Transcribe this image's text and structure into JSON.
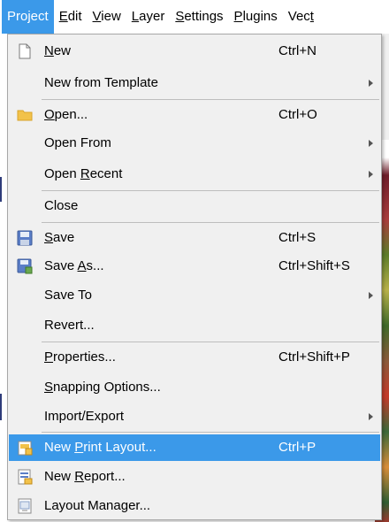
{
  "menubar": {
    "items": [
      {
        "label": "Project",
        "active": true
      },
      {
        "pre": "",
        "ul": "E",
        "post": "dit"
      },
      {
        "pre": "",
        "ul": "V",
        "post": "iew"
      },
      {
        "pre": "",
        "ul": "L",
        "post": "ayer"
      },
      {
        "pre": "",
        "ul": "S",
        "post": "ettings"
      },
      {
        "pre": "",
        "ul": "P",
        "post": "lugins"
      },
      {
        "pre": "Vec",
        "ul": "t",
        "post": ""
      }
    ]
  },
  "menu": {
    "items": [
      {
        "pre": "",
        "ul": "N",
        "post": "ew",
        "shortcut": "Ctrl+N",
        "icon": "new-file-icon"
      },
      {
        "pre": "New from Template",
        "ul": "",
        "post": "",
        "shortcut": "",
        "submenu": true
      },
      {
        "pre": "",
        "ul": "O",
        "post": "pen...",
        "shortcut": "Ctrl+O",
        "icon": "open-folder-icon"
      },
      {
        "pre": "Open From",
        "ul": "",
        "post": "",
        "shortcut": "",
        "submenu": true
      },
      {
        "pre": "Open ",
        "ul": "R",
        "post": "ecent",
        "shortcut": "",
        "submenu": true
      },
      {
        "pre": "Close",
        "ul": "",
        "post": "",
        "shortcut": ""
      },
      {
        "pre": "",
        "ul": "S",
        "post": "ave",
        "shortcut": "Ctrl+S",
        "icon": "save-icon"
      },
      {
        "pre": "Save ",
        "ul": "A",
        "post": "s...",
        "shortcut": "Ctrl+Shift+S",
        "icon": "save-as-icon"
      },
      {
        "pre": "Save To",
        "ul": "",
        "post": "",
        "shortcut": "",
        "submenu": true
      },
      {
        "pre": "Revert...",
        "ul": "",
        "post": "",
        "shortcut": ""
      },
      {
        "pre": "",
        "ul": "P",
        "post": "roperties...",
        "shortcut": "Ctrl+Shift+P"
      },
      {
        "pre": "",
        "ul": "S",
        "post": "napping Options...",
        "shortcut": ""
      },
      {
        "pre": "Import/Export",
        "ul": "",
        "post": "",
        "shortcut": "",
        "submenu": true
      },
      {
        "pre": "New ",
        "ul": "P",
        "post": "rint Layout...",
        "shortcut": "Ctrl+P",
        "icon": "print-layout-icon",
        "highlighted": true
      },
      {
        "pre": "New ",
        "ul": "R",
        "post": "eport...",
        "shortcut": "",
        "icon": "report-icon"
      },
      {
        "pre": "",
        "ul": "",
        "post": "Layout Manager...",
        "shortcut": "",
        "icon": "layout-manager-icon"
      }
    ]
  },
  "colors": {
    "highlight": "#3b99e9",
    "menu_bg": "#f0f0f0",
    "folder": "#f2c24a",
    "save": "#5b7ec7"
  }
}
